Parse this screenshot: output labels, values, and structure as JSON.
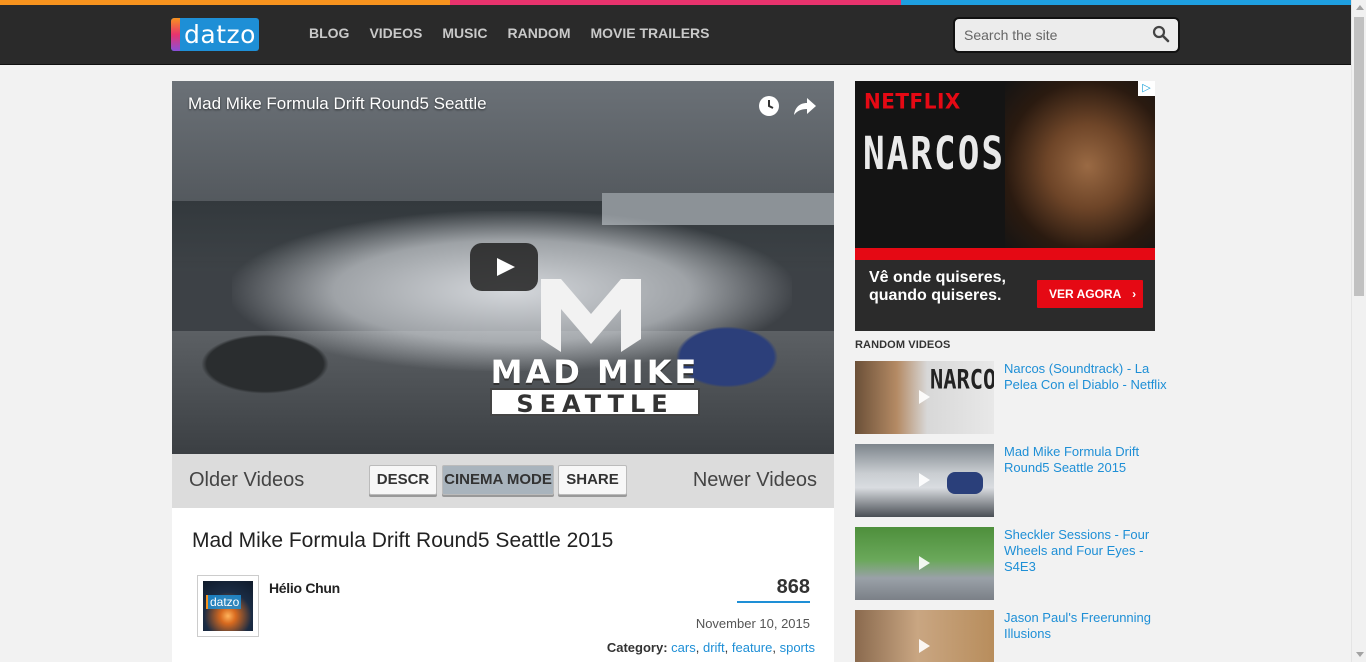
{
  "colors": {
    "stripe": [
      "#f7931e",
      "#e8336d",
      "#1e9fe0"
    ],
    "accent": "#1e8fd6",
    "header_bg": "#2a2a2a",
    "netflix_red": "#e50914"
  },
  "header": {
    "logo_text": "datzo",
    "nav": [
      "BLOG",
      "VIDEOS",
      "MUSIC",
      "RANDOM",
      "MOVIE TRAILERS"
    ],
    "search_placeholder": "Search the site"
  },
  "player": {
    "title": "Mad Mike Formula Drift Round5 Seattle",
    "watermark_line1": "MAD MIKE",
    "watermark_line2": "SEATTLE"
  },
  "controls": {
    "older": "Older Videos",
    "newer": "Newer Videos",
    "descr": "DESCR",
    "cinema": "CINEMA MODE",
    "share": "SHARE"
  },
  "video": {
    "title": "Mad Mike Formula Drift Round5 Seattle 2015",
    "author": "Hélio Chun",
    "avatar_text": "datzo",
    "views": "868",
    "date": "November 10, 2015",
    "category_label": "Category:",
    "categories": [
      "cars",
      "drift",
      "feature",
      "sports"
    ]
  },
  "ad": {
    "brand": "NETFLIX",
    "show": "NARCOS",
    "tagline_1": "Vê onde quiseres,",
    "tagline_2": "quando quiseres.",
    "cta": "VER AGORA",
    "cta_arrow": "›",
    "adchoices": "▷"
  },
  "sidebar": {
    "section_title": "RANDOM VIDEOS",
    "videos": [
      {
        "title": "Narcos (Soundtrack) - La Pelea Con el Diablo - Netflix"
      },
      {
        "title": "Mad Mike Formula Drift Round5 Seattle 2015"
      },
      {
        "title": "Sheckler Sessions - Four Wheels and Four Eyes - S4E3"
      },
      {
        "title": "Jason Paul's Freerunning Illusions"
      }
    ],
    "thumb_text_1": "NARCOS"
  }
}
